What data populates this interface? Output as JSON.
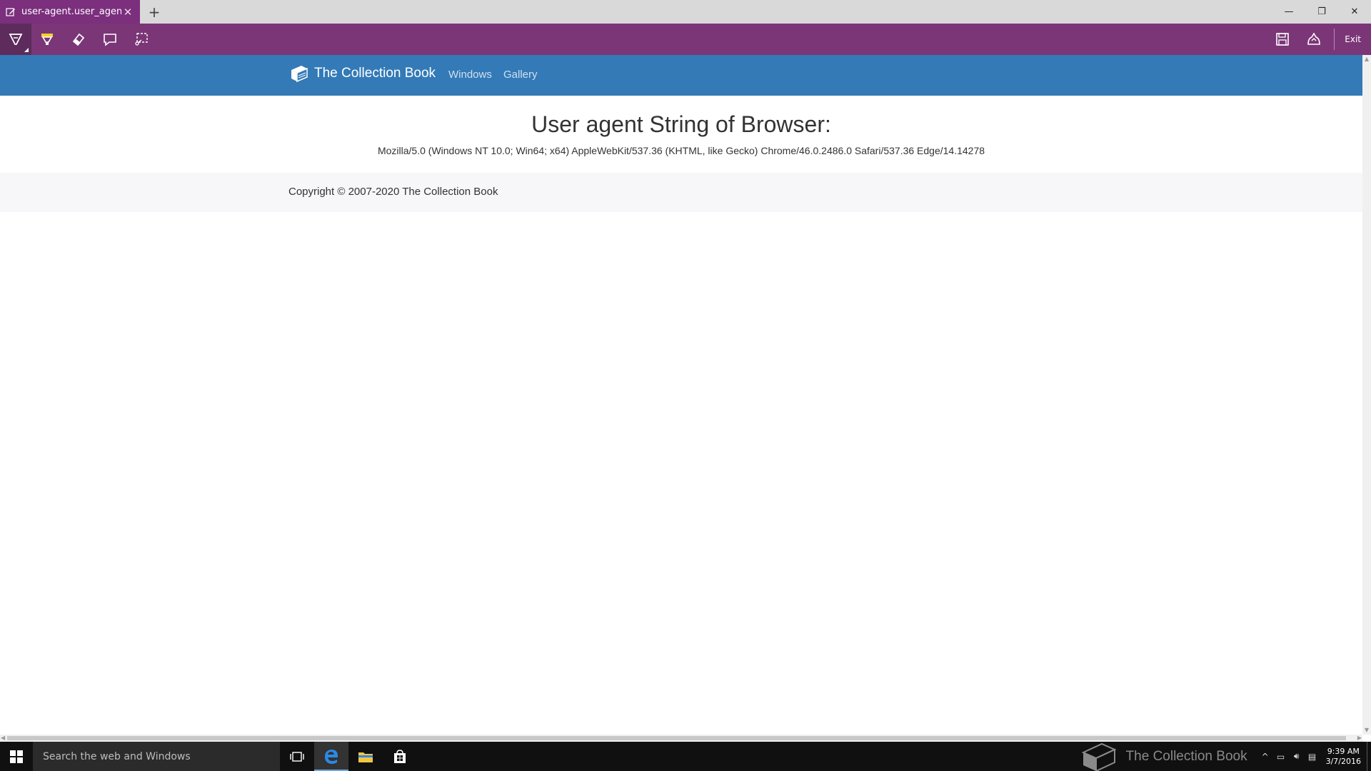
{
  "tab": {
    "title": "user-agent.user_agent -",
    "new_tab_label": "+"
  },
  "window_controls": {
    "minimize": "—",
    "restore": "❐",
    "close": "✕"
  },
  "note_toolbar": {
    "tools": [
      "pen-icon",
      "highlighter-icon",
      "eraser-icon",
      "comment-icon",
      "clip-icon"
    ],
    "exit_label": "Exit",
    "accent": "#7b3677"
  },
  "site": {
    "brand": "The Collection Book",
    "nav": [
      "Windows",
      "Gallery"
    ],
    "navbar_color": "#337ab7",
    "heading": "User agent String of Browser:",
    "user_agent": "Mozilla/5.0 (Windows NT 10.0; Win64; x64) AppleWebKit/537.36 (KHTML, like Gecko) Chrome/46.0.2486.0 Safari/537.36 Edge/14.14278",
    "copyright": "Copyright © 2007-2020 The Collection Book"
  },
  "taskbar": {
    "search_placeholder": "Search the web and Windows",
    "watermark": "The Collection Book",
    "time": "9:39 AM",
    "date": "3/7/2016"
  }
}
